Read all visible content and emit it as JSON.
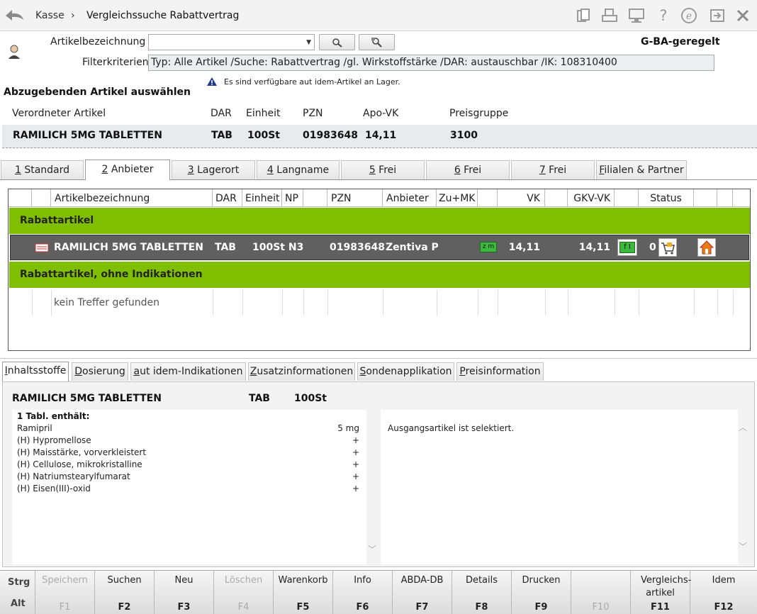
{
  "header": {
    "breadcrumb_root": "Kasse",
    "breadcrumb_sep": "›",
    "page_title": "Vergleichssuche Rabattvertrag"
  },
  "search": {
    "article_label": "Artikelbezeichnung",
    "article_value": "",
    "filter_label": "Filterkriterien",
    "filter_value": "Typ: Alle Artikel /Suche: Rabattvertrag /gl. Wirkstoffstärke /DAR: austauschbar /IK: 108310400",
    "gba_label": "G-BA-geregelt"
  },
  "notice": "Es sind verfügbare aut idem-Artikel an Lager.",
  "section_title": "Abzugebenden Artikel auswählen",
  "prescribed": {
    "headers": [
      "Verordneter Artikel",
      "DAR",
      "Einheit",
      "PZN",
      "Apo-VK",
      "Preisgruppe"
    ],
    "values": [
      "RAMILICH 5MG TABLETTEN",
      "TAB",
      "100St",
      "01983648",
      "14,11",
      "3100"
    ]
  },
  "tabs": [
    {
      "num": "1",
      "label": " Standard"
    },
    {
      "num": "2",
      "label": " Anbieter"
    },
    {
      "num": "3",
      "label": " Lagerort"
    },
    {
      "num": "4",
      "label": " Langname"
    },
    {
      "num": "5",
      "label": " Frei"
    },
    {
      "num": "6",
      "label": " Frei"
    },
    {
      "num": "7",
      "label": " Frei"
    },
    {
      "num": "F",
      "label": "ilialen & Partner"
    }
  ],
  "grid": {
    "columns": [
      "Artikelbezeichnung",
      "DAR",
      "Einheit",
      "NP",
      "PZN",
      "Anbieter",
      "Zu+MK",
      "VK",
      "GKV-VK",
      "Status"
    ],
    "group1": "Rabattartikel",
    "row": {
      "name": "RAMILICH 5MG TABLETTEN",
      "dar": "TAB",
      "einheit": "100St N3",
      "pzn": "01983648",
      "anbieter": "Zentiva Ph",
      "zumk_badge": "z m",
      "vk": "14,11",
      "gkv_vk": "14,11",
      "fi_badge": "f I",
      "status": "0"
    },
    "group2": "Rabattartikel, ohne Indikationen",
    "empty": "kein Treffer gefunden"
  },
  "bottom_tabs": [
    {
      "u": "I",
      "label": "nhaltsstoffe"
    },
    {
      "u": "D",
      "label": "osierung"
    },
    {
      "u": "a",
      "label": "ut idem-Indikationen"
    },
    {
      "u": "Z",
      "label": "usatzinformationen"
    },
    {
      "u": "S",
      "label": "ondenapplikation"
    },
    {
      "u": "P",
      "label": "reisinformation"
    }
  ],
  "detail": {
    "name": "RAMILICH 5MG TABLETTEN",
    "dar": "TAB",
    "unit": "100St",
    "contains_title": "1 Tabl. enthält:",
    "ingredients": [
      {
        "name": "Ramipril",
        "amount": "5 mg"
      },
      {
        "name": "(H) Hypromellose",
        "amount": "+"
      },
      {
        "name": "(H) Maisstärke, vorverkleistert",
        "amount": "+"
      },
      {
        "name": "(H) Cellulose, mikrokristalline",
        "amount": "+"
      },
      {
        "name": "(H) Natriumstearylfumarat",
        "amount": "+"
      },
      {
        "name": "(H) Eisen(III)-oxid",
        "amount": "+"
      }
    ],
    "message": "Ausgangsartikel ist selektiert."
  },
  "fkeys": {
    "modifiers": [
      "Strg",
      "Alt"
    ],
    "keys": [
      {
        "label": "Speichern",
        "key": "F1",
        "enabled": false
      },
      {
        "label": "Suchen",
        "key": "F2",
        "enabled": true
      },
      {
        "label": "Neu",
        "key": "F3",
        "enabled": true
      },
      {
        "label": "Löschen",
        "key": "F4",
        "enabled": false
      },
      {
        "label": "Warenkorb",
        "key": "F5",
        "enabled": true
      },
      {
        "label": "Info",
        "key": "F6",
        "enabled": true
      },
      {
        "label": "ABDA-DB",
        "key": "F7",
        "enabled": true
      },
      {
        "label": "Details",
        "key": "F8",
        "enabled": true
      },
      {
        "label": "Drucken",
        "key": "F9",
        "enabled": true
      },
      {
        "label": "",
        "key": "F10",
        "enabled": false
      },
      {
        "label": "Vergleichs-artikel",
        "key": "F11",
        "enabled": true
      },
      {
        "label": "Idem",
        "key": "F12",
        "enabled": true
      }
    ]
  },
  "colors": {
    "green_group": "#7fbf00",
    "selected_row": "#606060",
    "badge_green": "#3cb83c"
  },
  "icons": [
    "back-arrow-icon",
    "clipboard-icon",
    "print-icon",
    "monitor-icon",
    "help-icon",
    "e-icon",
    "export-icon",
    "close-icon",
    "search-icon",
    "search-detail-icon",
    "user-icon",
    "warning-icon",
    "package-icon",
    "cart-icon",
    "house-icon",
    "scroll-up-icon",
    "scroll-down-icon"
  ]
}
